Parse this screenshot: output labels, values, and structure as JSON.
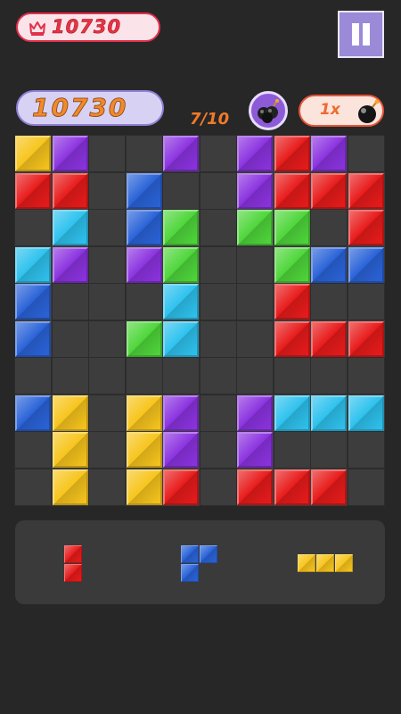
{
  "best": {
    "value": "10730",
    "icon": "crown-icon"
  },
  "pause": {
    "icon": "pause-icon"
  },
  "score": {
    "value": "10730"
  },
  "progress": {
    "text": "7/10"
  },
  "bomb": {
    "count_text": "1x",
    "icon": "bomb-icon"
  },
  "colors": {
    "Y": "#f7c51d",
    "P": "#8b33e0",
    "R": "#e81b1b",
    "B": "#2a63d8",
    "C": "#2ec2ee",
    "G": "#4fd63b"
  },
  "board": {
    "rows": [
      "YP..P.PRP.",
      "RR.B..PRRR",
      ".C.BG.GG.R",
      "CP.PG..GBB",
      "B...C..R..",
      "B..GC..RRR",
      "..........",
      "BY.YP.PCCC",
      ".Y.YP.P...",
      ".Y.YR.RRR."
    ]
  },
  "tray": {
    "pieces": [
      {
        "name": "vertical-red-domino",
        "color": "R",
        "cells": [
          [
            0,
            0
          ],
          [
            0,
            1
          ]
        ]
      },
      {
        "name": "blue-corner-piece",
        "color": "B",
        "cells": [
          [
            0,
            0
          ],
          [
            1,
            0
          ],
          [
            0,
            1
          ]
        ]
      },
      {
        "name": "horizontal-yellow-tromino",
        "color": "Y",
        "cells": [
          [
            0,
            0
          ],
          [
            1,
            0
          ],
          [
            2,
            0
          ]
        ]
      }
    ]
  }
}
